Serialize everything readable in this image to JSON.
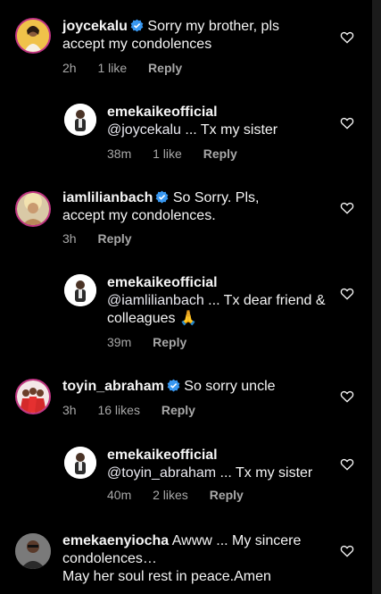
{
  "comments": [
    {
      "username": "joycekalu",
      "verified": true,
      "text": "Sorry my brother, pls accept my condolences",
      "time": "2h",
      "likes": "1 like",
      "reply": "Reply"
    },
    {
      "username": "emekaikeofficial",
      "verified": false,
      "mention": "@joycekalu",
      "text": " ... Tx my sister",
      "time": "38m",
      "likes": "1 like",
      "reply": "Reply"
    },
    {
      "username": "iamlilianbach",
      "verified": true,
      "text": "So Sorry. Pls, accept my condolences.",
      "time": "3h",
      "reply": "Reply"
    },
    {
      "username": "emekaikeofficial",
      "verified": false,
      "mention": "@iamlilianbach",
      "text": " ... Tx dear friend & colleagues 🙏",
      "time": "39m",
      "reply": "Reply"
    },
    {
      "username": "toyin_abraham",
      "verified": true,
      "text": "So sorry uncle",
      "time": "3h",
      "likes": "16 likes",
      "reply": "Reply"
    },
    {
      "username": "emekaikeofficial",
      "verified": false,
      "mention": "@toyin_abraham",
      "text": " ... Tx my sister",
      "time": "40m",
      "likes": "2 likes",
      "reply": "Reply"
    },
    {
      "username": "emekaenyiocha",
      "verified": false,
      "text": "Awww ... My sincere condolences…",
      "text2": "May her soul rest in peace.Amen"
    }
  ],
  "icons": {
    "verified": "verified-badge-icon",
    "like": "heart-outline-icon"
  },
  "colors": {
    "background": "#000000",
    "text": "#f5f5f5",
    "meta": "#a8a8a8",
    "verified": "#3897f0"
  }
}
